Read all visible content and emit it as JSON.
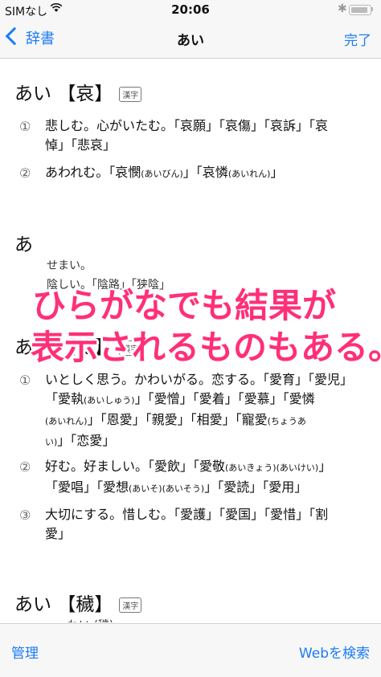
{
  "status": {
    "carrier": "SIMなし",
    "time": "20:06",
    "battery_level": 0.9
  },
  "nav": {
    "back_label": "辞書",
    "title": "あい",
    "done_label": "完了"
  },
  "entries": [
    {
      "reading": "あい",
      "kanji": "【哀】",
      "badge": "漢字",
      "senses": [
        {
          "num": "①",
          "lines": [
            "悲しむ。心がいたむ。「哀願」「哀傷」「哀訴」「哀",
            "悼」「悲哀」"
          ]
        },
        {
          "num": "②",
          "lines": [
            "あわれむ。「哀憫",
            "(あいびん)",
            "」「哀憐",
            "(あいれん)",
            "」"
          ]
        }
      ]
    },
    {
      "reading": "あ",
      "partial_lines": [
        "せまい。",
        "陰しい。「陰路」「狭陰」"
      ]
    },
    {
      "reading": "あい",
      "kanji": "【愛】",
      "badge": "漢字",
      "senses": [
        {
          "num": "①",
          "lines": [
            "いとしく思う。かわいがる。恋する。「愛育」「愛児」",
            "「愛執",
            "(あいしゅう)",
            "」「愛憎」「愛着」「愛慕」「愛憐",
            "(あいれん)",
            "」「恩愛」「親愛」「相愛」「寵愛",
            "(ちょうあ",
            "い)",
            "」「恋愛」"
          ]
        },
        {
          "num": "②",
          "lines": [
            "好む。好ましい。「愛飲」「愛敬",
            "(あいきょう)",
            "(あいけい)",
            "」",
            "「愛唱」「愛想",
            "(あいそ)",
            "(あいそう)",
            "」「愛読」「愛用」"
          ]
        },
        {
          "num": "③",
          "lines": [
            "大切にする。惜しむ。「愛護」「愛国」「愛惜」「割",
            "愛」"
          ]
        }
      ]
    },
    {
      "reading": "あい",
      "kanji": "【穢】",
      "badge": "漢字",
      "partial_lines": [
        "…わい (穢)"
      ]
    }
  ],
  "overlay": {
    "line1": "ひらがなでも結果が",
    "line2": "表示されるものもある。"
  },
  "toolbar": {
    "manage_label": "管理",
    "web_search_label": "Webを検索"
  }
}
